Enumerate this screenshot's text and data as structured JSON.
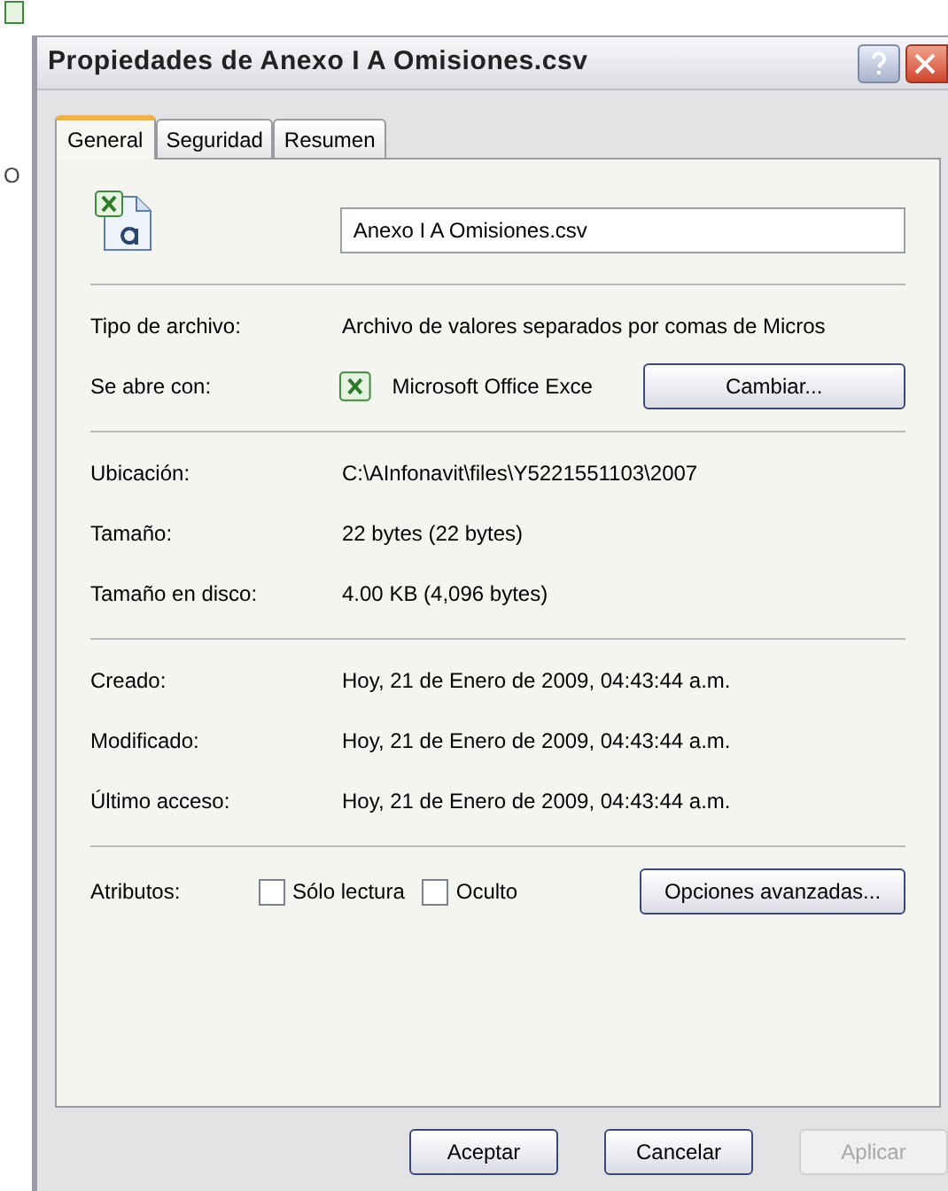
{
  "background": {
    "label": "O"
  },
  "window": {
    "title": "Propiedades de Anexo I A Omisiones.csv"
  },
  "tabs": [
    {
      "label": "General",
      "selected": true
    },
    {
      "label": "Seguridad",
      "selected": false
    },
    {
      "label": "Resumen",
      "selected": false
    }
  ],
  "file_name": {
    "value": "Anexo I A Omisiones.csv"
  },
  "groups": [
    [
      {
        "kind": "text",
        "label": "Tipo de archivo:",
        "value": "Archivo de valores separados por comas de Micros"
      },
      {
        "kind": "app",
        "label": "Se abre con:",
        "value": "Microsoft Office Exce",
        "button": "Cambiar..."
      }
    ],
    [
      {
        "kind": "text",
        "label": "Ubicación:",
        "value": "C:\\AInfonavit\\files\\Y5221551103\\2007"
      },
      {
        "kind": "text",
        "label": "Tamaño:",
        "value": "22 bytes (22 bytes)"
      },
      {
        "kind": "text",
        "label": "Tamaño en disco:",
        "value": "4.00 KB (4,096 bytes)"
      }
    ],
    [
      {
        "kind": "text",
        "label": "Creado:",
        "value": "Hoy, 21 de Enero de 2009, 04:43:44 a.m."
      },
      {
        "kind": "text",
        "label": "Modificado:",
        "value": "Hoy, 21 de Enero de 2009, 04:43:44 a.m."
      },
      {
        "kind": "text",
        "label": "Último acceso:",
        "value": "Hoy, 21 de Enero de 2009, 04:43:44 a.m."
      }
    ]
  ],
  "attributes": {
    "label": "Atributos:",
    "checkboxes": [
      {
        "label": "Sólo lectura",
        "checked": false
      },
      {
        "label": "Oculto",
        "checked": false
      }
    ],
    "button": "Opciones avanzadas..."
  },
  "buttons": [
    {
      "label": "Aceptar",
      "disabled": false
    },
    {
      "label": "Cancelar",
      "disabled": false
    },
    {
      "label": "Aplicar",
      "disabled": true
    }
  ]
}
